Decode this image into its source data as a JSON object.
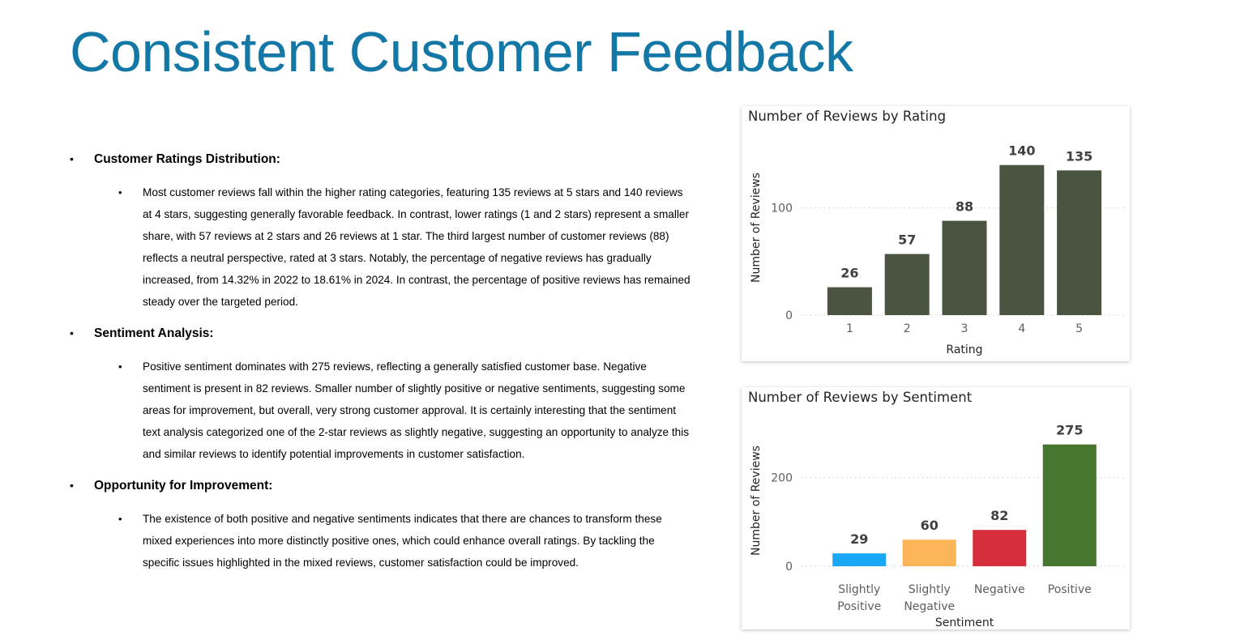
{
  "page": {
    "title": "Consistent Customer Feedback"
  },
  "sections": [
    {
      "heading": "Customer Ratings Distribution:",
      "body": "Most customer reviews fall within the higher rating categories, featuring 135 reviews at 5 stars and 140 reviews at 4 stars, suggesting generally favorable feedback. In contrast, lower ratings (1 and 2 stars) represent a smaller share, with 57 reviews at 2 stars and 26 reviews at 1 star. The third largest number of customer reviews (88) reflects a neutral perspective, rated at 3 stars. Notably, the percentage of negative reviews has gradually increased, from 14.32% in 2022 to 18.61% in 2024. In contrast, the percentage of positive reviews has remained steady over the targeted period."
    },
    {
      "heading": "Sentiment Analysis:",
      "body": "Positive sentiment dominates with 275 reviews, reflecting a generally satisfied customer base. Negative sentiment is present in 82 reviews. Smaller number of slightly positive or negative sentiments, suggesting some areas for improvement, but overall, very strong customer approval. It is certainly interesting that the sentiment text analysis categorized one of the 2-star reviews as slightly negative, suggesting an opportunity to analyze this and similar reviews to identify potential improvements in customer satisfaction."
    },
    {
      "heading": "Opportunity for Improvement:",
      "body": "The existence of both positive and negative sentiments indicates that there are chances to transform these mixed experiences into more distinctly positive ones, which could enhance overall ratings. By tackling the specific issues highlighted in the mixed reviews, customer satisfaction could be improved."
    }
  ],
  "bullets": {
    "primary": "•",
    "secondary": "•"
  },
  "chart_data": [
    {
      "type": "bar",
      "title": "Number of Reviews by Rating",
      "xlabel": "Rating",
      "ylabel": "Number of Reviews",
      "categories": [
        "1",
        "2",
        "3",
        "4",
        "5"
      ],
      "values": [
        26,
        57,
        88,
        140,
        135
      ],
      "yticks": [
        0,
        100
      ],
      "ylim": [
        0,
        150
      ],
      "grid": true,
      "colors": [
        "#4B5441",
        "#4B5441",
        "#4B5441",
        "#4B5441",
        "#4B5441"
      ]
    },
    {
      "type": "bar",
      "title": "Number of Reviews by Sentiment",
      "xlabel": "Sentiment",
      "ylabel": "Number of Reviews",
      "categories": [
        [
          "Slightly",
          "Positive"
        ],
        [
          "Slightly",
          "Negative"
        ],
        [
          "Negative"
        ],
        [
          "Positive"
        ]
      ],
      "values": [
        29,
        60,
        82,
        275
      ],
      "yticks": [
        0,
        200
      ],
      "ylim": [
        0,
        300
      ],
      "grid": true,
      "colors": [
        "#1AA7F5",
        "#FDB55A",
        "#D72E3D",
        "#467530"
      ]
    }
  ]
}
